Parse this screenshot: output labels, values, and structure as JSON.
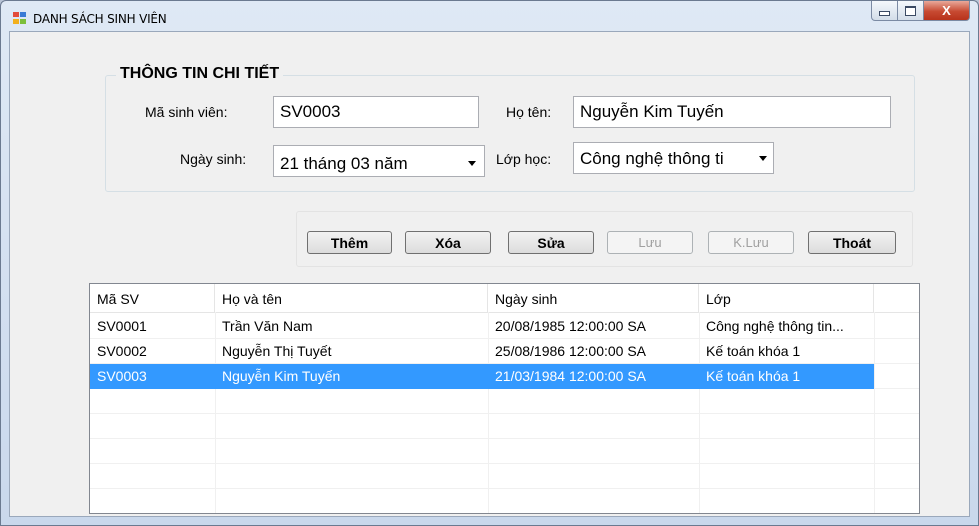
{
  "window": {
    "title": "DANH SÁCH SINH VIÊN",
    "close_glyph": "X"
  },
  "group": {
    "title": "THÔNG TIN CHI TIẾT",
    "student_id_label": "Mã sinh viên:",
    "student_id_value": "SV0003",
    "name_label": "Họ tên:",
    "name_value": "Nguyễn Kim Tuyến",
    "dob_label": "Ngày sinh:",
    "dob_value": "21  tháng  03  năm",
    "class_label": "Lớp học:",
    "class_value": "Công nghệ thông ti"
  },
  "buttons": {
    "add": "Thêm",
    "delete": "Xóa",
    "edit": "Sửa",
    "save": "Lưu",
    "no_save": "K.Lưu",
    "exit": "Thoát"
  },
  "list": {
    "columns": [
      "Mã SV",
      "Họ và tên",
      "Ngày sinh",
      "Lớp"
    ],
    "rows": [
      [
        "SV0001",
        "Trần Văn Nam",
        "20/08/1985 12:00:00 SA",
        "Công nghệ thông tin..."
      ],
      [
        "SV0002",
        "Nguyễn Thị Tuyết",
        "25/08/1986 12:00:00 SA",
        "Kế toán khóa 1"
      ],
      [
        "SV0003",
        "Nguyễn Kim Tuyến",
        "21/03/1984 12:00:00 SA",
        "Kế toán khóa 1"
      ]
    ],
    "selected_row": 2
  },
  "colors": {
    "selection": "#3399ff",
    "close_button": "#c74a32",
    "window_frame": "#c9d8ec"
  }
}
